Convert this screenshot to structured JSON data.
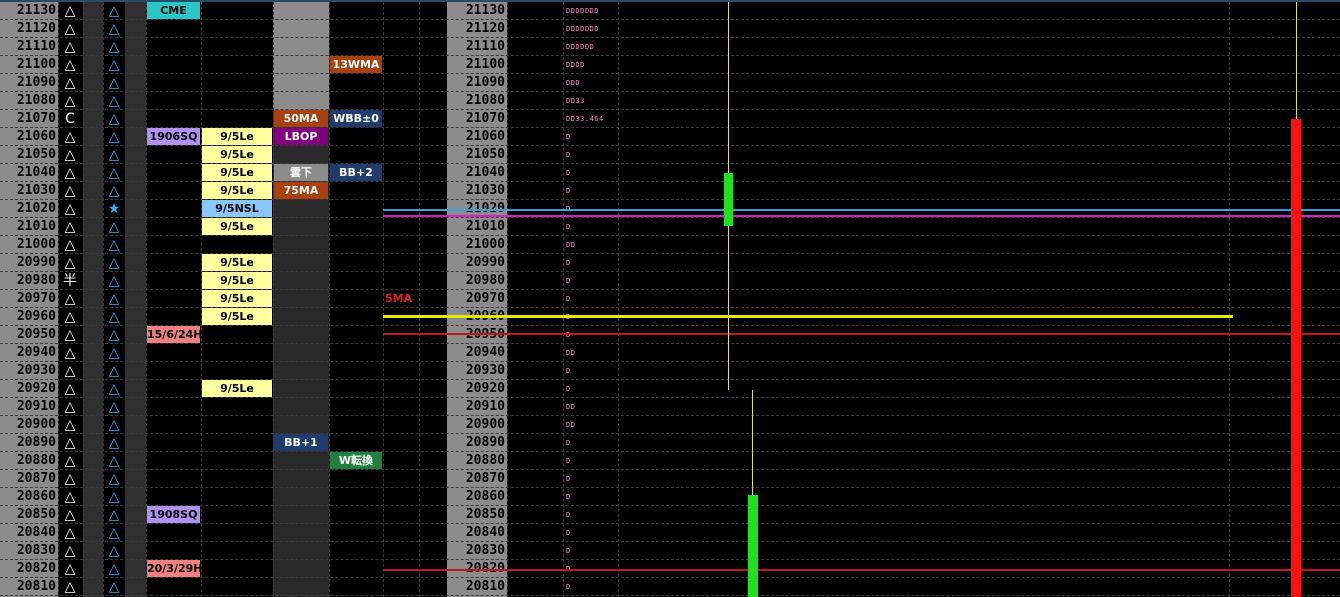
{
  "prices": [
    "21130",
    "21120",
    "21110",
    "21100",
    "21090",
    "21080",
    "21070",
    "21060",
    "21050",
    "21040",
    "21030",
    "21020",
    "21010",
    "21000",
    "20990",
    "20980",
    "20970",
    "20960",
    "20950",
    "20940",
    "20930",
    "20920",
    "20910",
    "20900",
    "20890",
    "20880",
    "20870",
    "20860",
    "20850",
    "20840",
    "20830",
    "20820",
    "20810"
  ],
  "markers": [
    "△",
    "△",
    "△",
    "△",
    "△",
    "△",
    "C",
    "△",
    "△",
    "△",
    "△",
    "△",
    "△",
    "△",
    "△",
    "半",
    "△",
    "△",
    "△",
    "△",
    "△",
    "△",
    "△",
    "△",
    "△",
    "△",
    "△",
    "△",
    "△",
    "△",
    "△",
    "△",
    "△"
  ],
  "markers2": [
    "△",
    "△",
    "△",
    "△",
    "△",
    "△",
    "△",
    "△",
    "△",
    "△",
    "△",
    "★",
    "△",
    "△",
    "△",
    "△",
    "△",
    "△",
    "△",
    "△",
    "△",
    "△",
    "△",
    "△",
    "△",
    "△",
    "△",
    "△",
    "△",
    "△",
    "△",
    "△",
    "△"
  ],
  "profile": [
    "DDDDDDD",
    "DDDDDDD",
    "DDDDDD",
    "DDDD",
    "DDD",
    "DD33",
    "DD33.464",
    "D",
    "D",
    "D",
    "D",
    "D",
    "D",
    "DD",
    "D",
    "D",
    "D",
    "D",
    "D",
    "DD",
    "D",
    "D",
    "DD",
    "DD",
    "D",
    "D",
    "D",
    "D",
    "D",
    "D",
    "D",
    "D",
    "D"
  ],
  "tags": {
    "cme": "CME",
    "sq1906": "1906SQ",
    "h15624": "15/6/24H",
    "sq1908": "1908SQ",
    "h20329": "20/3/29H",
    "le": "9/5Le",
    "nsl": "9/5NSL",
    "wma13": "13WMA",
    "ma50": "50MA",
    "wbb0": "WBB±0",
    "lbop": "LBOP",
    "kumo": "雲下",
    "bb2": "BB+2",
    "ma75": "75MA",
    "bb1": "BB+1",
    "wten": "W転換",
    "sma": "5MA"
  },
  "colors": {
    "price_col_bg": "#8c8c8c",
    "cme": "#28c8c8",
    "sq": "#b090f0",
    "pink": "#f08080",
    "le": "#ffffa0",
    "nsl": "#88c8ff",
    "orange": "#a84010",
    "navy": "#203c6c",
    "purple": "#800080",
    "green": "#208040",
    "candle_green": "#20e020",
    "candle_red": "#ff1010"
  }
}
